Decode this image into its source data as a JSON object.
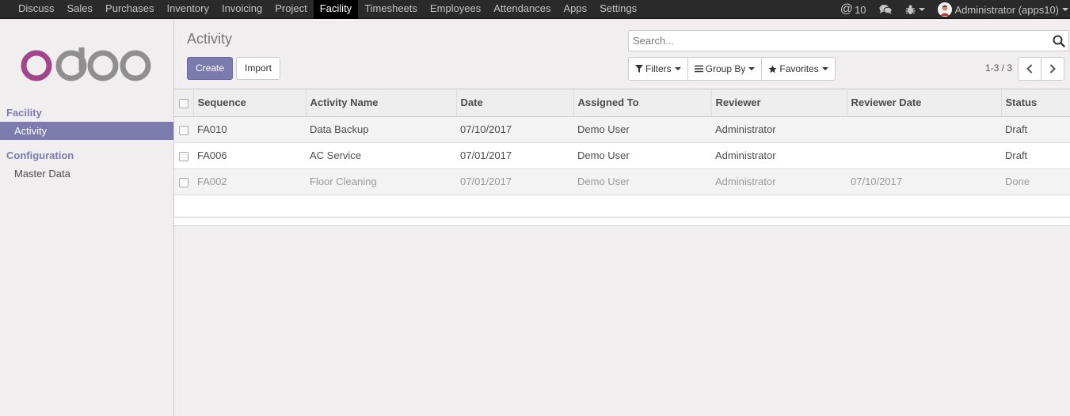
{
  "topbar": {
    "menu": [
      {
        "label": "Discuss"
      },
      {
        "label": "Sales"
      },
      {
        "label": "Purchases"
      },
      {
        "label": "Inventory"
      },
      {
        "label": "Invoicing"
      },
      {
        "label": "Project"
      },
      {
        "label": "Facility"
      },
      {
        "label": "Timesheets"
      },
      {
        "label": "Employees"
      },
      {
        "label": "Attendances"
      },
      {
        "label": "Apps"
      },
      {
        "label": "Settings"
      }
    ],
    "active_menu": "Facility",
    "mentions_count": "10",
    "user_name": "Administrator (apps10)",
    "icons": {
      "mentions": "at-icon",
      "chat": "comments-icon",
      "debug": "bug-icon"
    }
  },
  "sidebar": {
    "logo_text": "odoo",
    "sections": [
      {
        "title": "Facility",
        "items": [
          {
            "label": "Activity",
            "active": true
          }
        ]
      },
      {
        "title": "Configuration",
        "items": [
          {
            "label": "Master Data",
            "active": false
          }
        ]
      }
    ]
  },
  "control_panel": {
    "breadcrumb": "Activity",
    "create_label": "Create",
    "import_label": "Import",
    "search_placeholder": "Search...",
    "filters_label": "Filters",
    "group_by_label": "Group By",
    "favorites_label": "Favorites",
    "pager": "1-3 / 3"
  },
  "table": {
    "columns": [
      "Sequence",
      "Activity Name",
      "Date",
      "Assigned To",
      "Reviewer",
      "Reviewer Date",
      "Status"
    ],
    "rows": [
      {
        "sequence": "FA010",
        "name": "Data Backup",
        "date": "07/10/2017",
        "assigned": "Demo User",
        "reviewer": "Administrator",
        "reviewer_date": "",
        "status": "Draft"
      },
      {
        "sequence": "FA006",
        "name": "AC Service",
        "date": "07/01/2017",
        "assigned": "Demo User",
        "reviewer": "Administrator",
        "reviewer_date": "",
        "status": "Draft"
      },
      {
        "sequence": "FA002",
        "name": "Floor Cleaning",
        "date": "07/01/2017",
        "assigned": "Demo User",
        "reviewer": "Administrator",
        "reviewer_date": "07/10/2017",
        "status": "Done"
      }
    ]
  },
  "colors": {
    "brand": "#7c7bad",
    "logo_o": "#a24689",
    "logo_rest": "#8f8f8f",
    "topbar": "#2a2a2a"
  }
}
